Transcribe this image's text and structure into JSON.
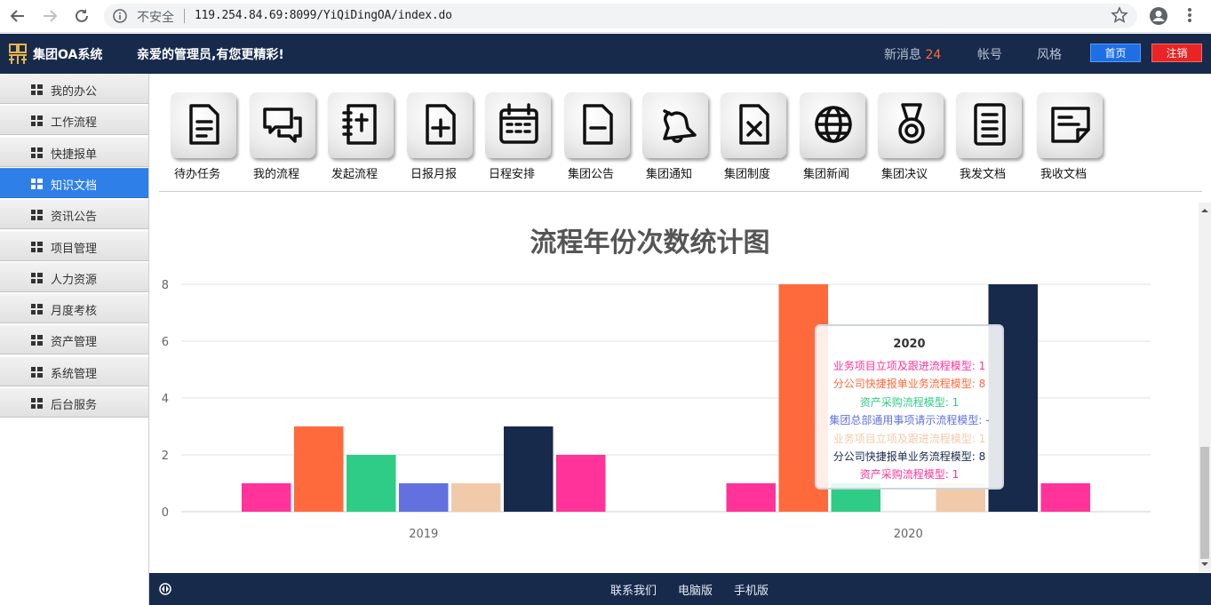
{
  "browser": {
    "insecure_label": "不安全",
    "url": "119.254.84.69:8099/YiQiDingOA/index.do"
  },
  "header": {
    "app_title": "集团OA系统",
    "greeting": "亲爱的管理员,有您更精彩!",
    "messages_label": "新消息",
    "messages_count": "24",
    "account_label": "帐号",
    "theme_label": "风格",
    "home_label": "首页",
    "logout_label": "注销"
  },
  "sidebar": {
    "items": [
      {
        "label": "我的办公",
        "active": false
      },
      {
        "label": "工作流程",
        "active": false
      },
      {
        "label": "快捷报单",
        "active": false
      },
      {
        "label": "知识文档",
        "active": true
      },
      {
        "label": "资讯公告",
        "active": false
      },
      {
        "label": "项目管理",
        "active": false
      },
      {
        "label": "人力资源",
        "active": false
      },
      {
        "label": "月度考核",
        "active": false
      },
      {
        "label": "资产管理",
        "active": false
      },
      {
        "label": "系统管理",
        "active": false
      },
      {
        "label": "后台服务",
        "active": false
      }
    ]
  },
  "quick_links": [
    {
      "label": "待办任务",
      "icon": "document-icon"
    },
    {
      "label": "我的流程",
      "icon": "chat-icon"
    },
    {
      "label": "发起流程",
      "icon": "notebook-icon"
    },
    {
      "label": "日报月报",
      "icon": "file-add-icon"
    },
    {
      "label": "日程安排",
      "icon": "calendar-icon"
    },
    {
      "label": "集团公告",
      "icon": "file-minus-icon"
    },
    {
      "label": "集团通知",
      "icon": "bell-icon"
    },
    {
      "label": "集团制度",
      "icon": "file-x-icon"
    },
    {
      "label": "集团新闻",
      "icon": "globe-icon"
    },
    {
      "label": "集团决议",
      "icon": "medal-icon"
    },
    {
      "label": "我发文档",
      "icon": "list-document-icon"
    },
    {
      "label": "我收文档",
      "icon": "note-icon"
    }
  ],
  "chart_data": {
    "type": "bar",
    "title": "流程年份次数统计图",
    "categories": [
      "2019",
      "2020"
    ],
    "ylim": [
      0,
      8
    ],
    "yticks": [
      "0",
      "2",
      "4",
      "6",
      "8"
    ],
    "grid": true,
    "series": [
      {
        "name": "业务项目立项及跟进流程模型",
        "color": "#ff3399",
        "values": [
          1,
          1
        ]
      },
      {
        "name": "分公司快捷报单业务流程模型",
        "color": "#ff6a3d",
        "values": [
          3,
          8
        ]
      },
      {
        "name": "资产采购流程模型",
        "color": "#2ecc87",
        "values": [
          2,
          1
        ]
      },
      {
        "name": "集团总部通用事项请示流程模型",
        "color": "#6171e0",
        "values": [
          1,
          null
        ]
      },
      {
        "name": "业务项目立项及跟进流程模型",
        "color": "#f1cba9",
        "values": [
          1,
          1
        ]
      },
      {
        "name": "分公司快捷报单业务流程模型",
        "color": "#172a4c",
        "values": [
          3,
          8
        ]
      },
      {
        "name": "资产采购流程模型",
        "color": "#ff3399",
        "values": [
          2,
          1
        ]
      }
    ]
  },
  "tooltip": {
    "title": "2020",
    "lines": [
      {
        "text": "业务项目立项及跟进流程模型: 1",
        "color": "#ff3399"
      },
      {
        "text": "分公司快捷报单业务流程模型: 8",
        "color": "#ff6a3d"
      },
      {
        "text": "资产采购流程模型: 1",
        "color": "#2ecc87"
      },
      {
        "text": "集团总部通用事项请示流程模型: -",
        "color": "#6171e0"
      },
      {
        "text": "业务项目立项及跟进流程模型: 1",
        "color": "#f1cba9"
      },
      {
        "text": "分公司快捷报单业务流程模型: 8",
        "color": "#172a4c"
      },
      {
        "text": "资产采购流程模型: 1",
        "color": "#ff3399"
      }
    ]
  },
  "footer": {
    "contact_label": "联系我们",
    "desktop_label": "电脑版",
    "mobile_label": "手机版"
  }
}
